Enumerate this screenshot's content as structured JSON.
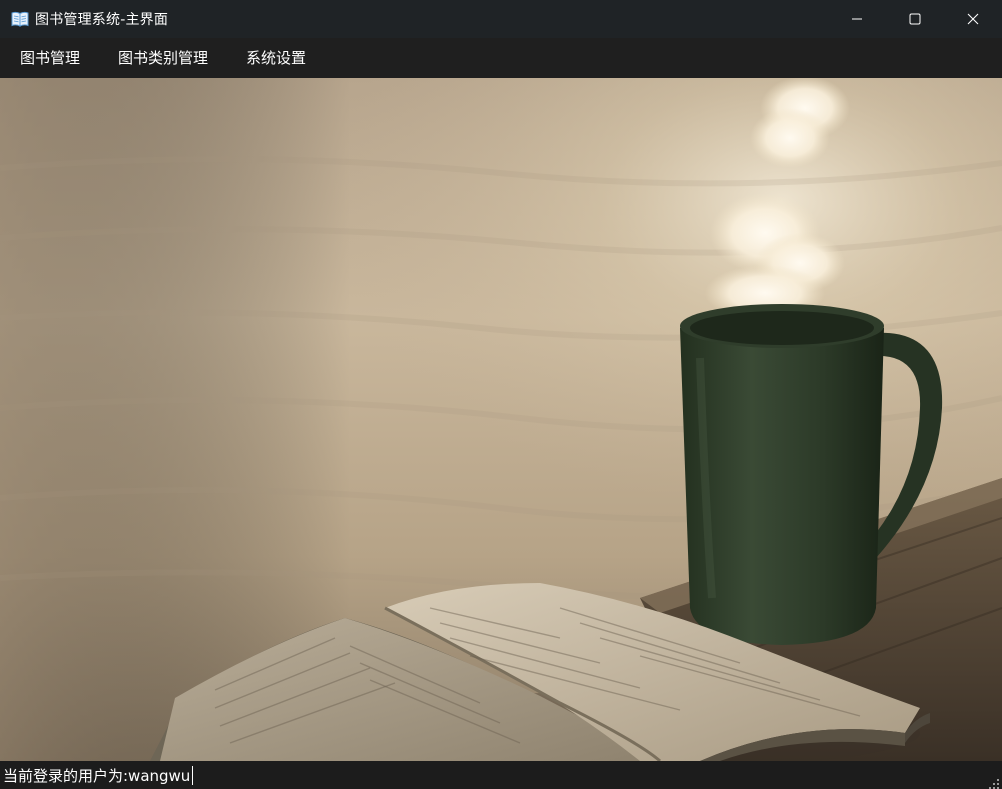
{
  "window": {
    "title": "图书管理系统-主界面",
    "icon": "book-icon"
  },
  "controls": {
    "minimize_icon": "minimize-icon",
    "maximize_icon": "maximize-icon",
    "close_icon": "close-icon"
  },
  "menu": {
    "items": [
      {
        "label": "图书管理"
      },
      {
        "label": "图书类别管理"
      },
      {
        "label": "系统设置"
      }
    ]
  },
  "content": {
    "background_image": "coffee mug and open book photo"
  },
  "status": {
    "current_user_text": "当前登录的用户为:wangwu"
  },
  "colors": {
    "titlebar": "#1f2326",
    "menubar": "#1f1f1f",
    "statusbar": "#1c1c1c",
    "text": "#ffffff"
  }
}
